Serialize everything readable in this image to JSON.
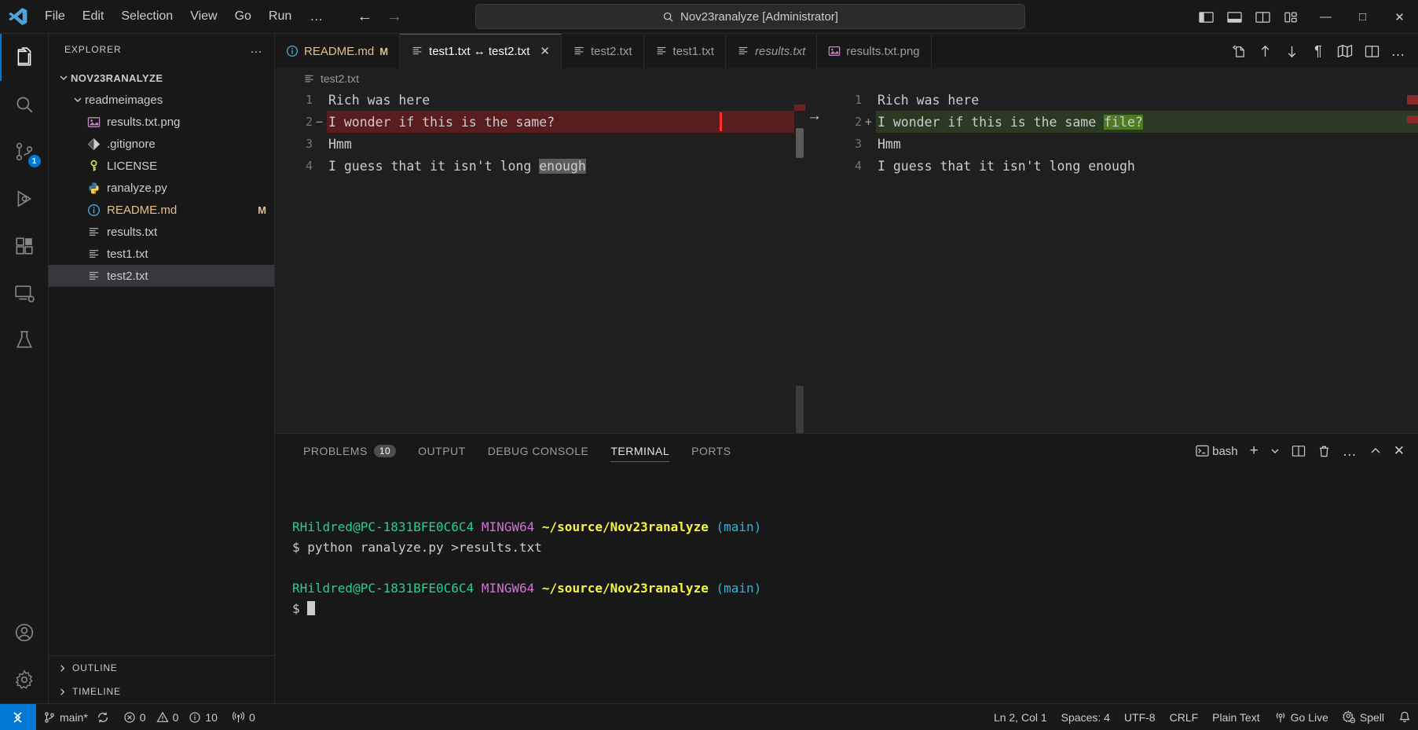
{
  "titlebar": {
    "menu": [
      "File",
      "Edit",
      "Selection",
      "View",
      "Go",
      "Run"
    ],
    "overflow_label": "…",
    "command_center": "Nov23ranalyze [Administrator]",
    "search_icon": "search-icon",
    "back_label": "←",
    "forward_label": "→",
    "minimize_label": "—",
    "maximize_label": "□",
    "close_label": "✕"
  },
  "activitybar": {
    "items": [
      {
        "name": "explorer",
        "badge": null
      },
      {
        "name": "search",
        "badge": null
      },
      {
        "name": "source-control",
        "badge": "1"
      },
      {
        "name": "run-and-debug",
        "badge": null
      },
      {
        "name": "extensions",
        "badge": null
      },
      {
        "name": "remote-explorer",
        "badge": null
      },
      {
        "name": "testing",
        "badge": null
      }
    ],
    "bottom": [
      {
        "name": "accounts"
      },
      {
        "name": "settings"
      }
    ]
  },
  "sidebar": {
    "title": "EXPLORER",
    "more_label": "…",
    "root": "NOV23RANALYZE",
    "files": [
      {
        "label": "readmeimages",
        "icon": "folder-icon",
        "indent": 1,
        "expanded": true,
        "type": "folder",
        "badge": "",
        "selected": false,
        "modified": false
      },
      {
        "label": "results.txt.png",
        "icon": "image-icon",
        "indent": 2,
        "type": "file",
        "badge": "",
        "selected": false,
        "modified": false
      },
      {
        "label": ".gitignore",
        "icon": "git-icon",
        "indent": 1,
        "type": "file",
        "badge": "",
        "selected": false,
        "modified": false
      },
      {
        "label": "LICENSE",
        "icon": "key-icon",
        "indent": 1,
        "type": "file",
        "badge": "",
        "selected": false,
        "modified": false
      },
      {
        "label": "ranalyze.py",
        "icon": "python-icon",
        "indent": 1,
        "type": "file",
        "badge": "",
        "selected": false,
        "modified": false
      },
      {
        "label": "README.md",
        "icon": "info-icon",
        "indent": 1,
        "type": "file",
        "badge": "M",
        "selected": false,
        "modified": true
      },
      {
        "label": "results.txt",
        "icon": "text-icon",
        "indent": 1,
        "type": "file",
        "badge": "",
        "selected": false,
        "modified": false
      },
      {
        "label": "test1.txt",
        "icon": "text-icon",
        "indent": 1,
        "type": "file",
        "badge": "",
        "selected": false,
        "modified": false
      },
      {
        "label": "test2.txt",
        "icon": "text-icon",
        "indent": 1,
        "type": "file",
        "badge": "",
        "selected": true,
        "modified": false
      }
    ],
    "sections": [
      {
        "label": "OUTLINE"
      },
      {
        "label": "TIMELINE"
      }
    ]
  },
  "tabs": [
    {
      "label": "README.md",
      "icon": "info-icon",
      "dirty": "M",
      "active": false,
      "italic": false,
      "amber": true,
      "closable": false
    },
    {
      "label": "test1.txt ↔ test2.txt",
      "icon": "text-icon",
      "dirty": "",
      "active": true,
      "italic": false,
      "amber": false,
      "closable": true
    },
    {
      "label": "test2.txt",
      "icon": "text-icon",
      "dirty": "",
      "active": false,
      "italic": false,
      "amber": false,
      "closable": false
    },
    {
      "label": "test1.txt",
      "icon": "text-icon",
      "dirty": "",
      "active": false,
      "italic": false,
      "amber": false,
      "closable": false
    },
    {
      "label": "results.txt",
      "icon": "text-icon",
      "dirty": "",
      "active": false,
      "italic": true,
      "amber": false,
      "closable": false
    },
    {
      "label": "results.txt.png",
      "icon": "image-icon",
      "dirty": "",
      "active": false,
      "italic": false,
      "amber": false,
      "closable": false
    }
  ],
  "tab_actions": [
    {
      "name": "open-changes-icon"
    },
    {
      "name": "previous-change-icon"
    },
    {
      "name": "next-change-icon"
    },
    {
      "name": "toggle-whitespace-icon"
    },
    {
      "name": "map-icon"
    },
    {
      "name": "split-editor-icon"
    },
    {
      "name": "more-actions-icon"
    }
  ],
  "diff": {
    "left": {
      "header": "test2.txt",
      "header_icon": "text-icon",
      "lines": [
        {
          "num": "1",
          "sign": "",
          "kind": "normal",
          "segments": [
            {
              "t": "Rich was here",
              "hl": ""
            }
          ]
        },
        {
          "num": "2",
          "sign": "−",
          "kind": "del",
          "segments": [
            {
              "t": "I wonder if this is the same?",
              "hl": ""
            }
          ]
        },
        {
          "num": "3",
          "sign": "",
          "kind": "normal",
          "segments": [
            {
              "t": "Hmm",
              "hl": ""
            }
          ]
        },
        {
          "num": "4",
          "sign": "",
          "kind": "normal",
          "segments": [
            {
              "t": "I guess that it isn't long ",
              "hl": ""
            },
            {
              "t": "enough",
              "hl": "sel"
            }
          ]
        }
      ]
    },
    "right": {
      "lines": [
        {
          "num": "1",
          "sign": "",
          "kind": "normal",
          "segments": [
            {
              "t": "Rich was here",
              "hl": ""
            }
          ]
        },
        {
          "num": "2",
          "sign": "+",
          "kind": "add",
          "segments": [
            {
              "t": "I wonder if this is the same ",
              "hl": ""
            },
            {
              "t": "file?",
              "hl": "wadd"
            }
          ]
        },
        {
          "num": "3",
          "sign": "",
          "kind": "normal",
          "segments": [
            {
              "t": "Hmm",
              "hl": ""
            }
          ]
        },
        {
          "num": "4",
          "sign": "",
          "kind": "normal",
          "segments": [
            {
              "t": "I guess that it isn't long enough",
              "hl": ""
            }
          ]
        }
      ]
    },
    "change_arrow": "→"
  },
  "panel": {
    "tabs": [
      {
        "label": "PROBLEMS",
        "badge": "10",
        "active": false
      },
      {
        "label": "OUTPUT",
        "badge": "",
        "active": false
      },
      {
        "label": "DEBUG CONSOLE",
        "badge": "",
        "active": false
      },
      {
        "label": "TERMINAL",
        "badge": "",
        "active": true
      },
      {
        "label": "PORTS",
        "badge": "",
        "active": false
      }
    ],
    "shell_label": "bash",
    "actions": [
      {
        "name": "new-terminal-icon",
        "label": "+"
      },
      {
        "name": "terminal-dropdown-icon",
        "label": "⌄"
      },
      {
        "name": "split-terminal-icon",
        "label": ""
      },
      {
        "name": "kill-terminal-icon",
        "label": ""
      },
      {
        "name": "terminal-more-icon",
        "label": "…"
      },
      {
        "name": "maximize-panel-icon",
        "label": "⌃"
      },
      {
        "name": "close-panel-icon",
        "label": "✕"
      }
    ],
    "terminal": {
      "blocks": [
        {
          "prompt": {
            "user": "RHildred@PC-1831BFE0C6C4",
            "shell": "MINGW64",
            "path": "~/source/Nov23ranalyze",
            "branch": "(main)"
          },
          "command": "$ python ranalyze.py >results.txt"
        },
        {
          "prompt": {
            "user": "RHildred@PC-1831BFE0C6C4",
            "shell": "MINGW64",
            "path": "~/source/Nov23ranalyze",
            "branch": "(main)"
          },
          "command": "$ "
        }
      ]
    }
  },
  "statusbar": {
    "remote_icon": "remote-window-icon",
    "branch": "main*",
    "sync_icon": "sync-icon",
    "errors": "0",
    "warnings": "0",
    "infos": "10",
    "radio_tower": "0",
    "right": [
      {
        "name": "editor-position",
        "label": "Ln 2, Col 1"
      },
      {
        "name": "indentation",
        "label": "Spaces: 4"
      },
      {
        "name": "encoding",
        "label": "UTF-8"
      },
      {
        "name": "eol",
        "label": "CRLF"
      },
      {
        "name": "language-mode",
        "label": "Plain Text"
      },
      {
        "name": "go-live",
        "label": "Go Live"
      },
      {
        "name": "spell-checker",
        "label": "Spell"
      },
      {
        "name": "notifications",
        "label": ""
      }
    ]
  },
  "colors": {
    "accent": "#0078d4",
    "diff_delete": "#5a1d1d",
    "diff_insert": "#2b3a22",
    "modified": "#e2c08d"
  }
}
